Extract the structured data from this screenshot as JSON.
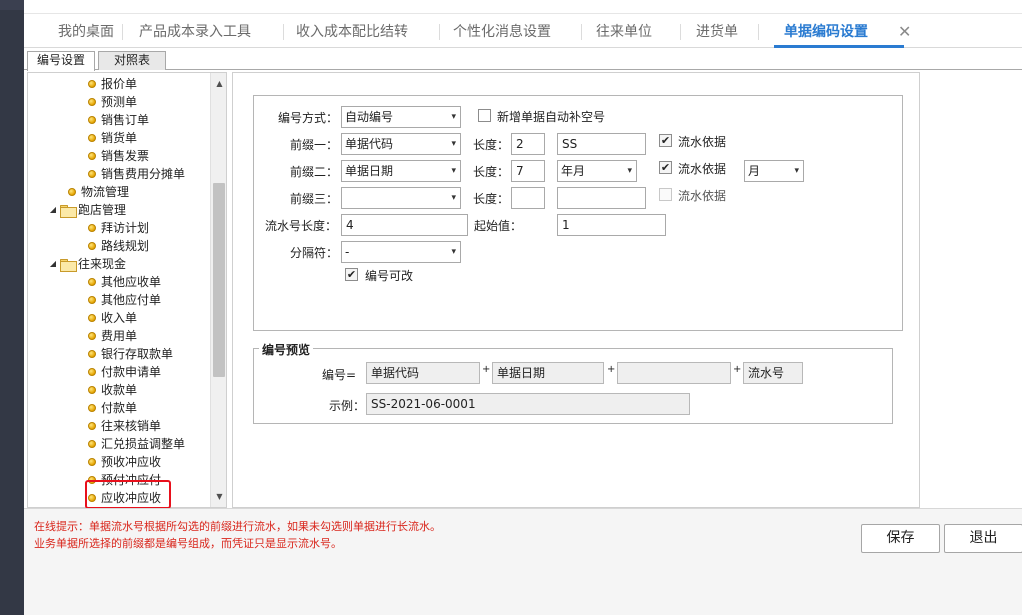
{
  "main_tabs": [
    {
      "label": "我的桌面"
    },
    {
      "label": "产品成本录入工具"
    },
    {
      "label": "收入成本配比结转"
    },
    {
      "label": "个性化消息设置"
    },
    {
      "label": "往来单位"
    },
    {
      "label": "进货单"
    },
    {
      "label": "单据编码设置",
      "active": true,
      "close": "✕"
    }
  ],
  "sub_tabs": [
    {
      "label": "编号设置",
      "active": true
    },
    {
      "label": "对照表"
    }
  ],
  "tree": {
    "items": [
      {
        "label": "报价单",
        "type": "leaf"
      },
      {
        "label": "预测单",
        "type": "leaf"
      },
      {
        "label": "销售订单",
        "type": "leaf"
      },
      {
        "label": "销货单",
        "type": "leaf"
      },
      {
        "label": "销售发票",
        "type": "leaf"
      },
      {
        "label": "销售费用分摊单",
        "type": "leaf"
      },
      {
        "label": "物流管理",
        "type": "leaf"
      },
      {
        "label": "跑店管理",
        "type": "folder"
      },
      {
        "label": "拜访计划",
        "type": "leaf"
      },
      {
        "label": "路线规划",
        "type": "leaf"
      },
      {
        "label": "往来现金",
        "type": "folder"
      },
      {
        "label": "其他应收单",
        "type": "leaf"
      },
      {
        "label": "其他应付单",
        "type": "leaf"
      },
      {
        "label": "收入单",
        "type": "leaf"
      },
      {
        "label": "费用单",
        "type": "leaf"
      },
      {
        "label": "银行存取款单",
        "type": "leaf"
      },
      {
        "label": "付款申请单",
        "type": "leaf"
      },
      {
        "label": "收款单",
        "type": "leaf"
      },
      {
        "label": "付款单",
        "type": "leaf"
      },
      {
        "label": "往来核销单",
        "type": "leaf"
      },
      {
        "label": "汇兑损益调整单",
        "type": "leaf"
      },
      {
        "label": "预收冲应收",
        "type": "leaf"
      },
      {
        "label": "预付冲应付",
        "type": "leaf"
      },
      {
        "label": "应收冲应收",
        "type": "leaf",
        "selected": true
      }
    ],
    "expand_glyph": "◢",
    "scroll_up": "▲",
    "scroll_down": "▼"
  },
  "form": {
    "mode_label": "编号方式：",
    "mode_value": "自动编号",
    "auto_fill_label": "新增单据自动补空号",
    "auto_fill_checked": false,
    "prefix1_label": "前缀一：",
    "prefix1_value": "单据代码",
    "length1_label": "长度：",
    "length1_value": "2",
    "prefix1_text": "SS",
    "flow1_label": "流水依据",
    "flow1_checked": true,
    "prefix2_label": "前缀二：",
    "prefix2_value": "单据日期",
    "length2_label": "长度：",
    "length2_value": "7",
    "prefix2_format": "年月",
    "flow2_label": "流水依据",
    "flow2_checked": true,
    "flow2_period": "月",
    "prefix3_label": "前缀三：",
    "prefix3_value": "",
    "length3_label": "长度：",
    "length3_value": "",
    "prefix3_text": "",
    "flow3_label": "流水依据",
    "flow3_checked": false,
    "serial_length_label": "流水号长度：",
    "serial_length_value": "4",
    "start_label": "起始值：",
    "start_value": "1",
    "separator_label": "分隔符：",
    "separator_value": "-",
    "editable_label": "编号可改",
    "editable_checked": true
  },
  "preview": {
    "legend": "编号预览",
    "number_label": "编号=",
    "part1": "单据代码",
    "part2": "单据日期",
    "part3": "",
    "part4": "流水号",
    "plus": "+",
    "example_label": "示例：",
    "example_value": "SS-2021-06-0001"
  },
  "hints": [
    "在线提示：单据流水号根据所勾选的前缀进行流水，如果未勾选则单据进行长流水。",
    "业务单据所选择的前缀都是编号组成，而凭证只是显示流水号。"
  ],
  "buttons": {
    "save": "保存",
    "exit": "退出"
  },
  "glyphs": {
    "arrow": "▾",
    "check": "✔"
  },
  "colors": {
    "accent": "#2a7bd1",
    "hint": "#d9261c",
    "highlight": "#e8101c",
    "strip": "#333845"
  }
}
